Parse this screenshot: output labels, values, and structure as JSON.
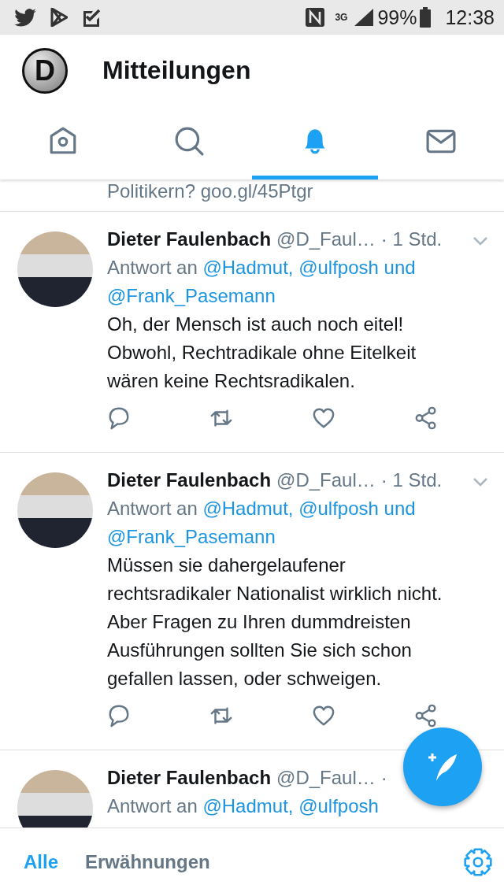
{
  "status_bar": {
    "network": "3G",
    "battery": "99%",
    "time": "12:38"
  },
  "header": {
    "logo_letter": "D",
    "title": "Mitteilungen"
  },
  "tabs": [
    {
      "selected": false
    },
    {
      "selected": false
    },
    {
      "selected": true
    },
    {
      "selected": false
    }
  ],
  "feed": {
    "clipped_text": "Politikern? goo.gl/45Ptgr",
    "tweets": [
      {
        "name": "Dieter Faulenbach",
        "handle": "@D_Faul…",
        "time": "· 1 Std.",
        "reply_prefix": "Antwort an",
        "reply_to": "@Hadmut, @ulfposh und @Frank_Pasemann",
        "text": "Oh, der Mensch ist auch noch eitel!\nObwohl, Rechtradikale ohne Eitelkeit\nwären keine Rechtsradikalen."
      },
      {
        "name": "Dieter Faulenbach",
        "handle": "@D_Faul…",
        "time": "· 1 Std.",
        "reply_prefix": "Antwort an",
        "reply_to": "@Hadmut, @ulfposh und @Frank_Pasemann",
        "text": "Müssen sie dahergelaufener\nrechtsradikaler Nationalist wirklich nicht.\nAber Fragen zu Ihren dummdreisten\nAusführungen sollten Sie sich schon\ngefallen lassen, oder schweigen."
      },
      {
        "name": "Dieter Faulenbach",
        "handle": "@D_Faul…",
        "time": "·",
        "reply_prefix": "Antwort an",
        "reply_to": "@Hadmut, @ulfposh"
      }
    ]
  },
  "bottom_tabs": [
    {
      "label": "Alle",
      "selected": true
    },
    {
      "label": "Erwähnungen",
      "selected": false
    }
  ]
}
